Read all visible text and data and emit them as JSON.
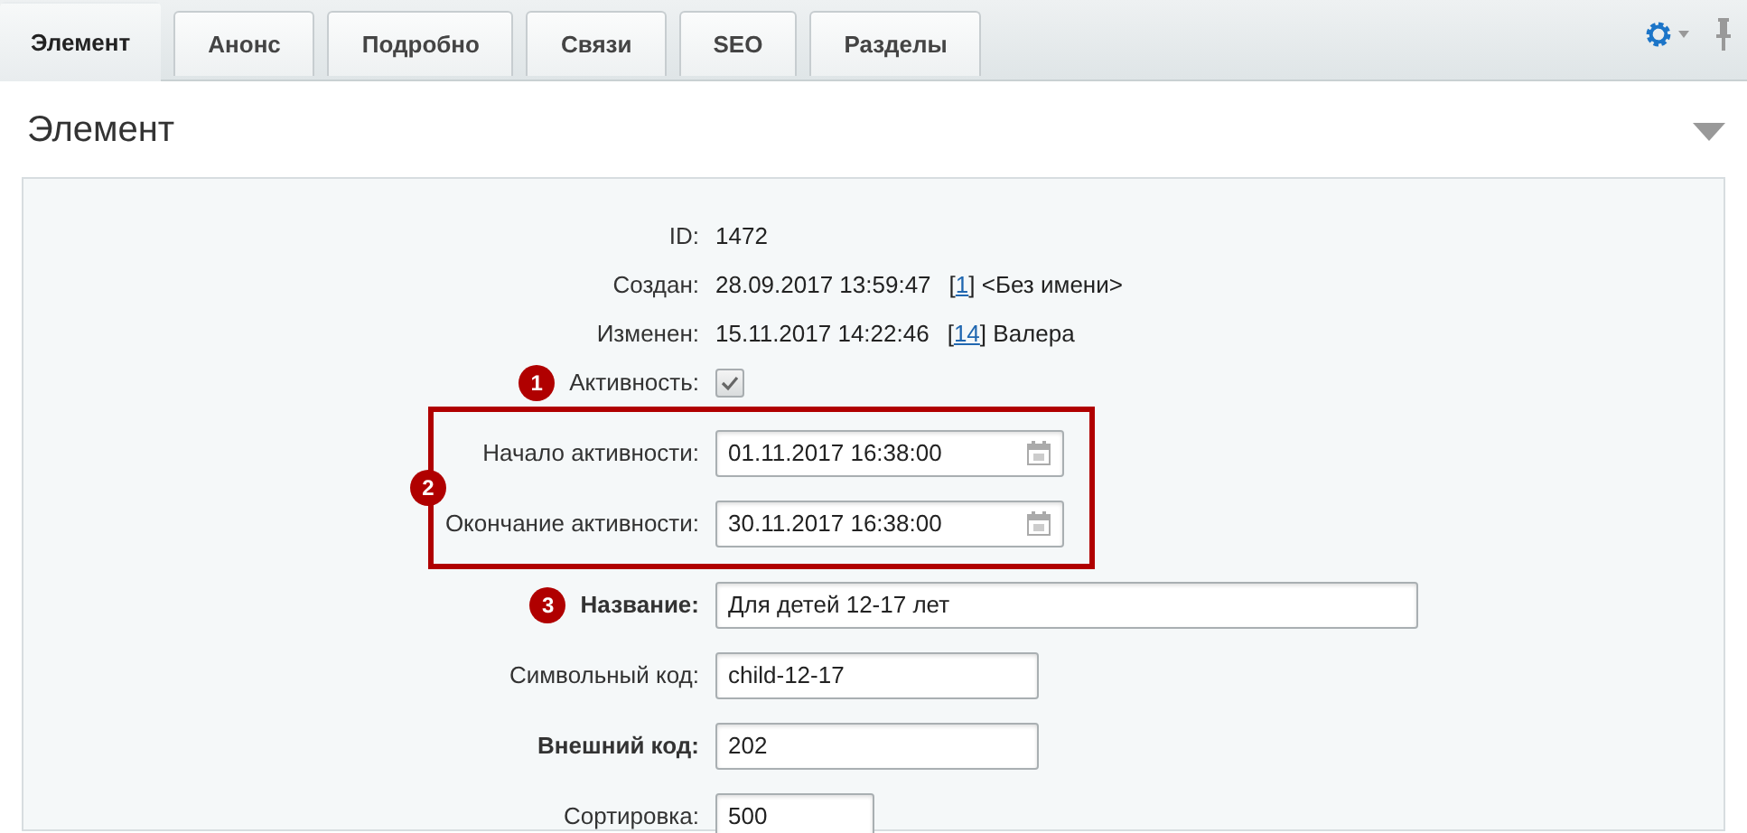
{
  "tabs": [
    {
      "label": "Элемент",
      "selected": true
    },
    {
      "label": "Анонс",
      "selected": false
    },
    {
      "label": "Подробно",
      "selected": false
    },
    {
      "label": "Связи",
      "selected": false
    },
    {
      "label": "SEO",
      "selected": false
    },
    {
      "label": "Разделы",
      "selected": false
    }
  ],
  "section": {
    "title": "Элемент",
    "expanded": true
  },
  "rows": [
    {
      "kind": "text",
      "label": "ID:",
      "value": "1472"
    },
    {
      "kind": "author",
      "label": "Создан:",
      "value": "28.09.2017 13:59:47",
      "open": "[",
      "link": "1",
      "after": "] <Без имени>"
    },
    {
      "kind": "author",
      "label": "Изменен:",
      "value": "15.11.2017 14:22:46",
      "open": "[",
      "link": "14",
      "after": "] Валера"
    },
    {
      "kind": "checkbox",
      "label": "Активность:",
      "checked": true,
      "badge": "1"
    },
    {
      "kind": "group",
      "badge": "2",
      "rows": [
        {
          "kind": "date",
          "label": "Начало активности:",
          "value": "01.11.2017 16:38:00"
        },
        {
          "kind": "date",
          "label": "Окончание активности:",
          "value": "30.11.2017 16:38:00"
        }
      ]
    },
    {
      "kind": "wide_input",
      "label": "Название:",
      "bold": true,
      "value": "Для детей 12-17 лет",
      "badge": "3"
    },
    {
      "kind": "medium_input",
      "label": "Символьный код:",
      "bold": false,
      "value": "child-12-17"
    },
    {
      "kind": "medium_input",
      "label": "Внешний код:",
      "bold": true,
      "value": "202"
    },
    {
      "kind": "small_input",
      "label": "Сортировка:",
      "bold": false,
      "value": "500"
    }
  ]
}
